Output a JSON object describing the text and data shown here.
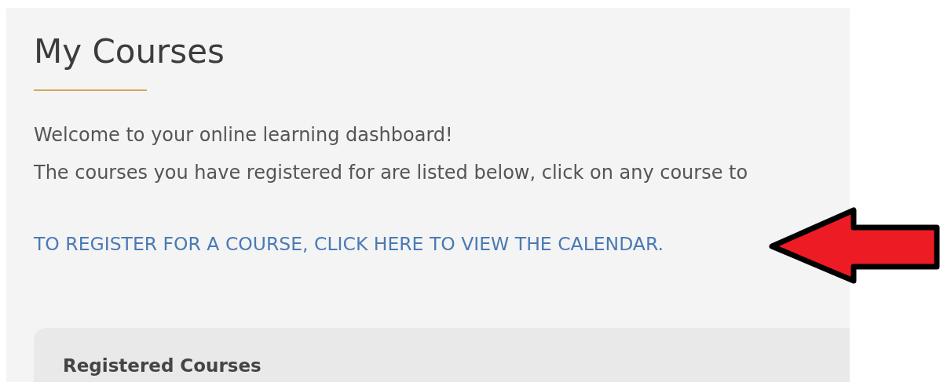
{
  "page": {
    "title": "My Courses",
    "intro": [
      "Welcome to your online learning dashboard!",
      "The courses you have registered for are listed below, click on any course to"
    ],
    "register_link": "TO REGISTER FOR A COURSE, CLICK HERE TO VIEW THE CALENDAR.",
    "registered_courses": {
      "heading": "Registered Courses"
    }
  }
}
